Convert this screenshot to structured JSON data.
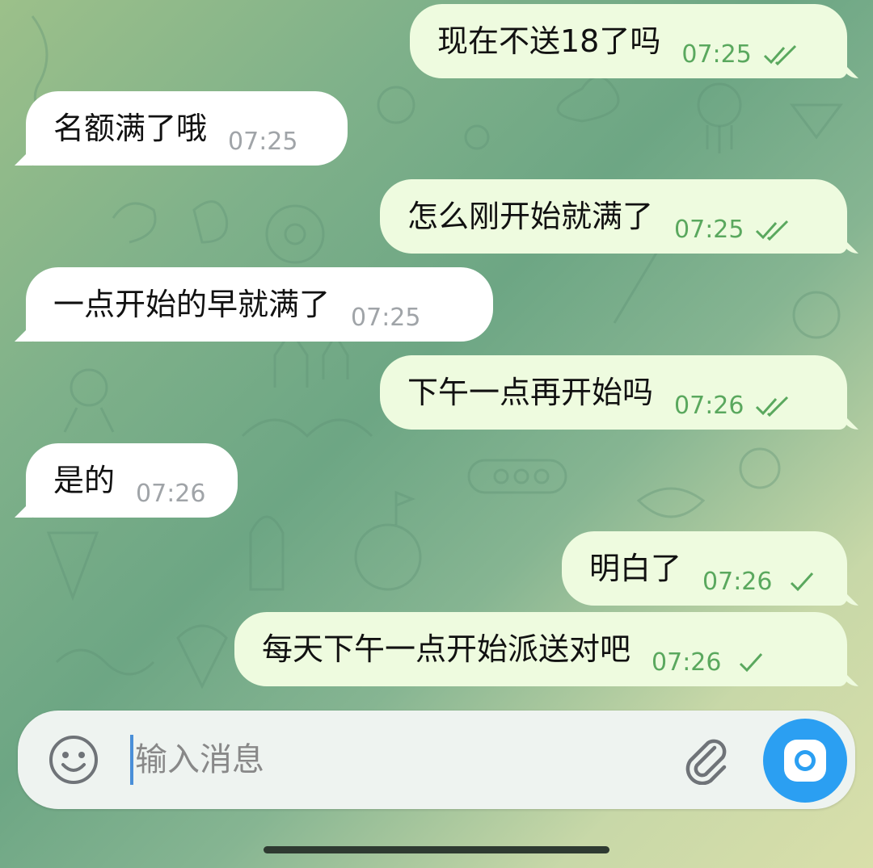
{
  "messages": [
    {
      "direction": "out",
      "text": "现在不送18了吗",
      "time": "07:25",
      "status": "read"
    },
    {
      "direction": "in",
      "text": "名额满了哦",
      "time": "07:25"
    },
    {
      "direction": "out",
      "text": "怎么刚开始就满了",
      "time": "07:25",
      "status": "read"
    },
    {
      "direction": "in",
      "text": "一点开始的早就满了",
      "time": "07:25"
    },
    {
      "direction": "out",
      "text": "下午一点再开始吗",
      "time": "07:26",
      "status": "read"
    },
    {
      "direction": "in",
      "text": "是的",
      "time": "07:26"
    },
    {
      "direction": "out",
      "text": "明白了",
      "time": "07:26",
      "status": "sent"
    },
    {
      "direction": "out",
      "text": "每天下午一点开始派送对吧",
      "time": "07:26",
      "status": "sent"
    }
  ],
  "composer": {
    "placeholder": "输入消息",
    "emoji_icon": "smiley-icon",
    "attach_icon": "paperclip-icon",
    "camera_icon": "camera-icon"
  },
  "colors": {
    "outgoing_bubble": "#eefbdf",
    "incoming_bubble": "#ffffff",
    "outgoing_meta": "#5aa85e",
    "incoming_meta": "#a0a4a8",
    "camera_button": "#2b9ff2"
  }
}
